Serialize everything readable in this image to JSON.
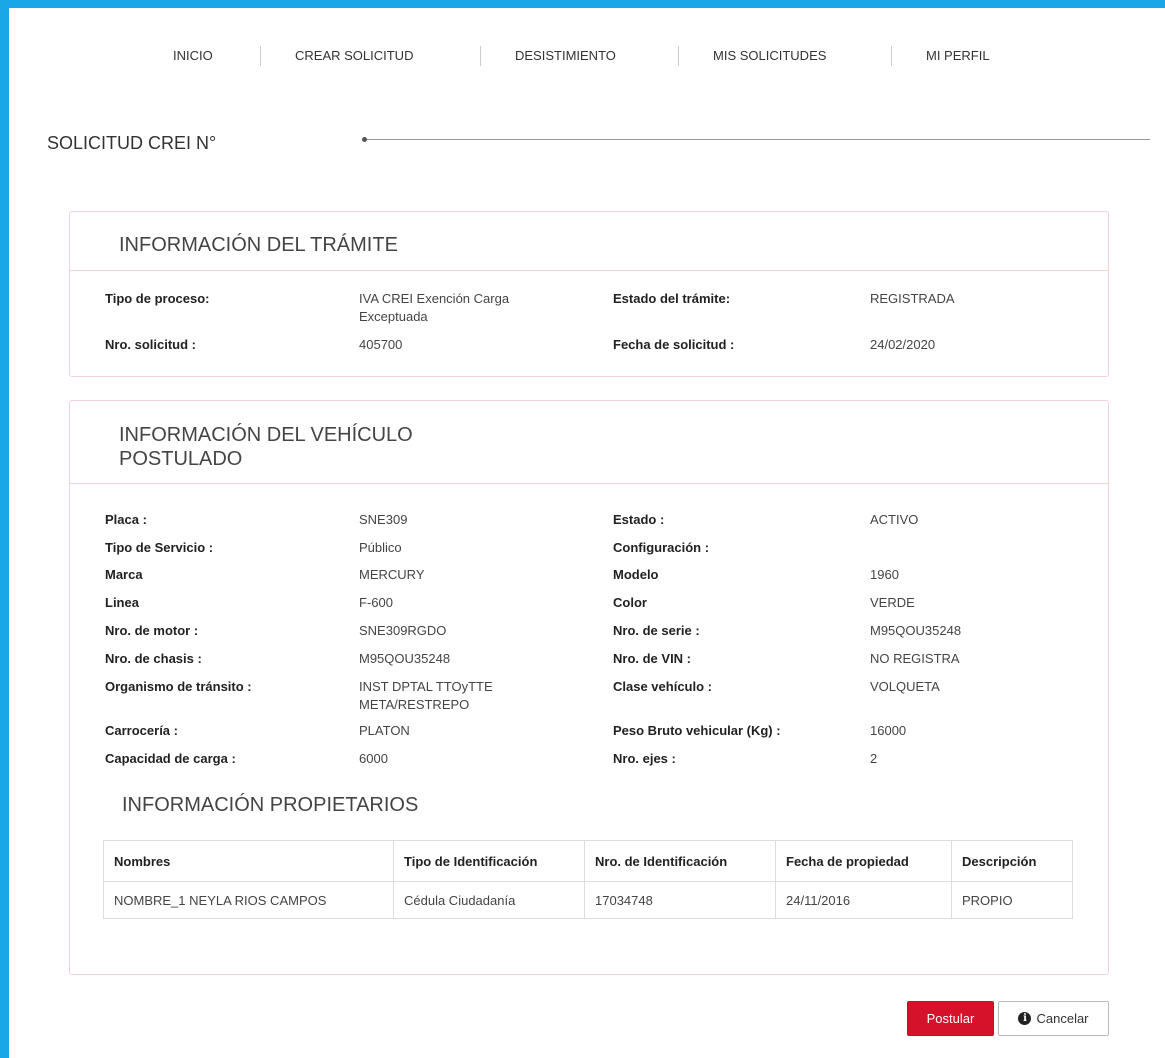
{
  "nav": {
    "items": [
      "INICIO",
      "CREAR SOLICITUD",
      "DESISTIMIENTO",
      "MIS SOLICITUDES",
      "MI PERFIL"
    ]
  },
  "page": {
    "title": "SOLICITUD CREI N°"
  },
  "tramite": {
    "title": "INFORMACIÓN DEL TRÁMITE",
    "tipo_proceso_label": "Tipo de proceso:",
    "tipo_proceso_value": "IVA CREI Exención Carga Exceptuada",
    "estado_label": "Estado del trámite:",
    "estado_value": "REGISTRADA",
    "nro_solicitud_label": "Nro. solicitud :",
    "nro_solicitud_value": "405700",
    "fecha_label": "Fecha de solicitud :",
    "fecha_value": "24/02/2020"
  },
  "vehiculo": {
    "title": "INFORMACIÓN DEL VEHÍCULO POSTULADO",
    "left": [
      {
        "label": "Placa :",
        "value": "SNE309"
      },
      {
        "label": "Tipo de Servicio :",
        "value": "Público"
      },
      {
        "label": "Marca",
        "value": "MERCURY"
      },
      {
        "label": "Linea",
        "value": "F-600"
      },
      {
        "label": "Nro. de motor :",
        "value": "SNE309RGDO"
      },
      {
        "label": "Nro. de chasis :",
        "value": "M95QOU35248"
      },
      {
        "label": "Organismo de tránsito :",
        "value": "INST DPTAL TTOyTTE META/RESTREPO"
      },
      {
        "label": "Carrocería :",
        "value": "PLATON"
      },
      {
        "label": "Capacidad de carga :",
        "value": "6000"
      }
    ],
    "right": [
      {
        "label": "Estado :",
        "value": "ACTIVO"
      },
      {
        "label": "Configuración :",
        "value": ""
      },
      {
        "label": "Modelo",
        "value": "1960"
      },
      {
        "label": "Color",
        "value": "VERDE"
      },
      {
        "label": "Nro. de serie :",
        "value": "M95QOU35248"
      },
      {
        "label": "Nro. de VIN :",
        "value": "NO REGISTRA"
      },
      {
        "label": "Clase vehículo :",
        "value": "VOLQUETA"
      },
      {
        "label": "Peso Bruto vehicular (Kg) :",
        "value": "16000"
      },
      {
        "label": "Nro. ejes :",
        "value": "2"
      }
    ]
  },
  "propietarios": {
    "title": "INFORMACIÓN PROPIETARIOS",
    "columns": [
      "Nombres",
      "Tipo de Identificación",
      "Nro. de Identificación",
      "Fecha de propiedad",
      "Descripción"
    ],
    "rows": [
      [
        "NOMBRE_1 NEYLA RIOS CAMPOS",
        "Cédula Ciudadanía",
        "17034748",
        "24/11/2016",
        "PROPIO"
      ]
    ]
  },
  "actions": {
    "postular": "Postular",
    "cancelar": "Cancelar",
    "cancel_icon": "info-circle-icon"
  },
  "colors": {
    "accent_border": "#1aa7e8",
    "primary_button": "#d6112a",
    "panel_border": "#f2d4d8"
  }
}
